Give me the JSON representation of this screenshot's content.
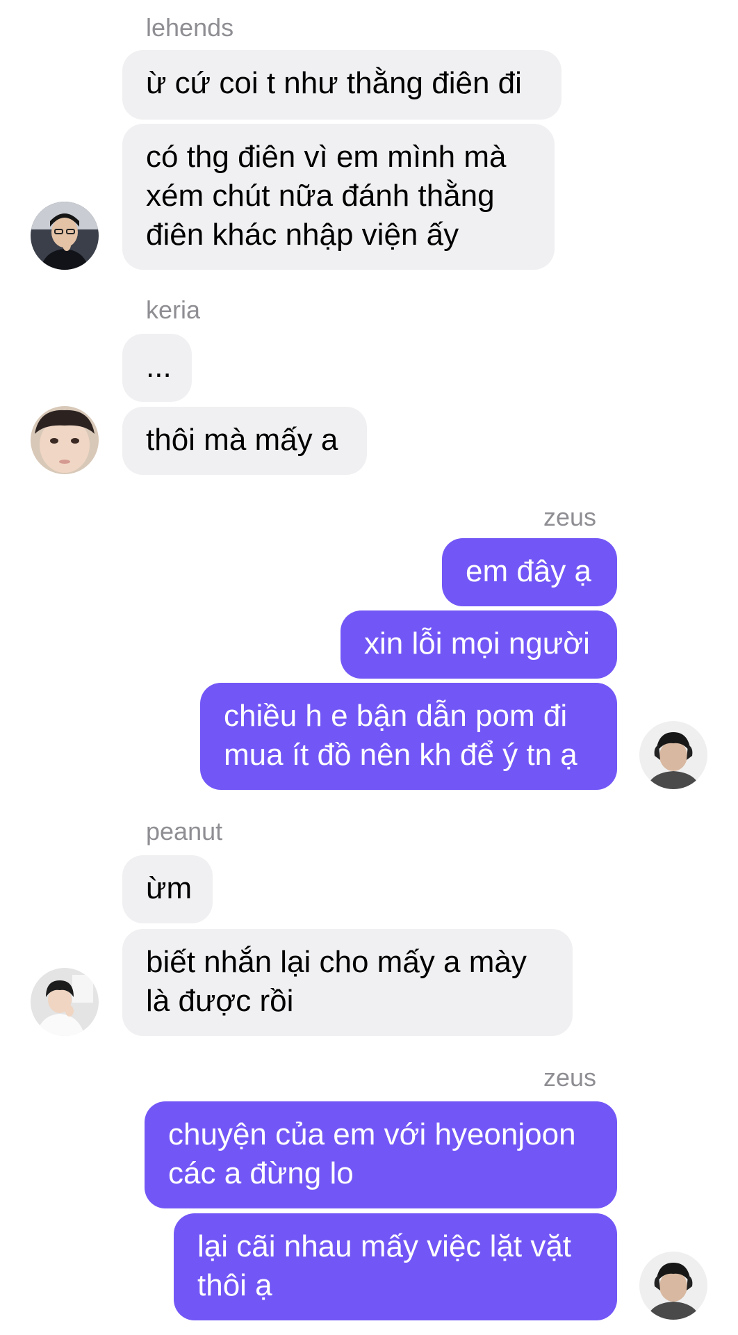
{
  "colors": {
    "incoming_bubble": "#f0f0f2",
    "outgoing_bubble": "#7357f6",
    "sender_name": "#8e8e93"
  },
  "groups": [
    {
      "sender": "lehends",
      "direction": "incoming",
      "avatar": "lehends-avatar",
      "messages": [
        "ừ cứ coi t như thằng điên đi",
        "có thg điên vì em mình mà\nxém chút nữa đánh thằng\nđiên khác nhập viện ấy"
      ]
    },
    {
      "sender": "keria",
      "direction": "incoming",
      "avatar": "keria-avatar",
      "messages": [
        "...",
        "thôi mà mấy a"
      ]
    },
    {
      "sender": "zeus",
      "direction": "outgoing",
      "avatar": "zeus-avatar",
      "messages": [
        "em đây ạ",
        "xin lỗi mọi người",
        "chiều h e bận dẫn pom đi\nmua ít đồ nên kh để ý tn ạ"
      ]
    },
    {
      "sender": "peanut",
      "direction": "incoming",
      "avatar": "peanut-avatar",
      "messages": [
        "ừm",
        "biết nhắn lại cho mấy a mày\nlà được rồi"
      ]
    },
    {
      "sender": "zeus",
      "direction": "outgoing",
      "avatar": "zeus-avatar",
      "messages": [
        "chuyện của em với hyeonjoon\ncác a đừng lo",
        "lại cãi nhau mấy việc lặt vặt\nthôi ạ"
      ]
    }
  ]
}
